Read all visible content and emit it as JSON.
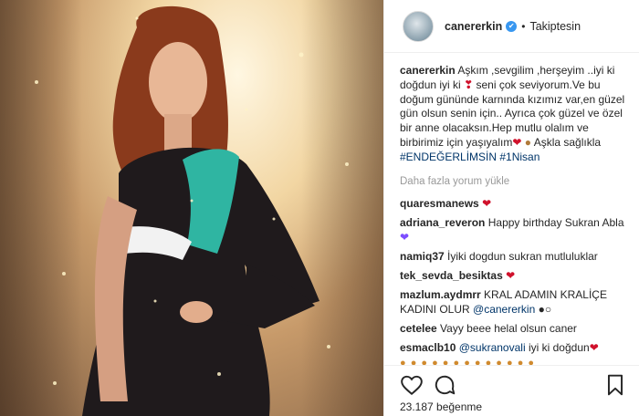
{
  "header": {
    "username": "canererkin",
    "verified_mark": "✔",
    "separator": "•",
    "follow_status": "Takiptesin"
  },
  "caption": {
    "username": "canererkin",
    "text_1": "Aşkım ,sevgilim ,herşeyim ..iyi ki doğdun iyi ki",
    "text_2": "seni çok seviyorum.Ve bu doğum gününde karnında kızımız var,en güzel gün olsun senin için.. Ayrıca çok güzel ve özel bir anne olacaksın.Hep mutlu olalım ve birbirimiz için yaşıyalım",
    "text_3": "Aşkla sağlıkla",
    "hashtag_1": "#ENDEĞERLİMSİN",
    "hashtag_2": "#1Nisan"
  },
  "load_more": "Daha fazla yorum yükle",
  "comments": [
    {
      "username": "quaresmanews",
      "text": ""
    },
    {
      "username": "adriana_reveron",
      "text": "Happy birthday Sukran Abla"
    },
    {
      "username": "namiq37",
      "text": "İyiki dogdun sukran mutluluklar"
    },
    {
      "username": "tek_sevda_besiktas",
      "text": ""
    },
    {
      "username": "mazlum.aydmrr",
      "text": "KRAL ADAMIN KRALİÇE KADINI OLUR",
      "mention": "@canererkin"
    },
    {
      "username": "cetelee",
      "text": "Vayy beee helal olsun caner"
    },
    {
      "username": "esmaclb10",
      "mention": "@sukranovali",
      "text": "iyi ki doğdun"
    }
  ],
  "likes": "23.187 beğenme",
  "icons": {
    "like": "heart-outline-icon",
    "comment": "speech-bubble-icon",
    "save": "bookmark-icon",
    "verified": "verified-badge-icon"
  },
  "colors": {
    "hashtag": "#003569",
    "verified": "#3897f0",
    "muted": "#999999",
    "heart": "#d0112b"
  }
}
